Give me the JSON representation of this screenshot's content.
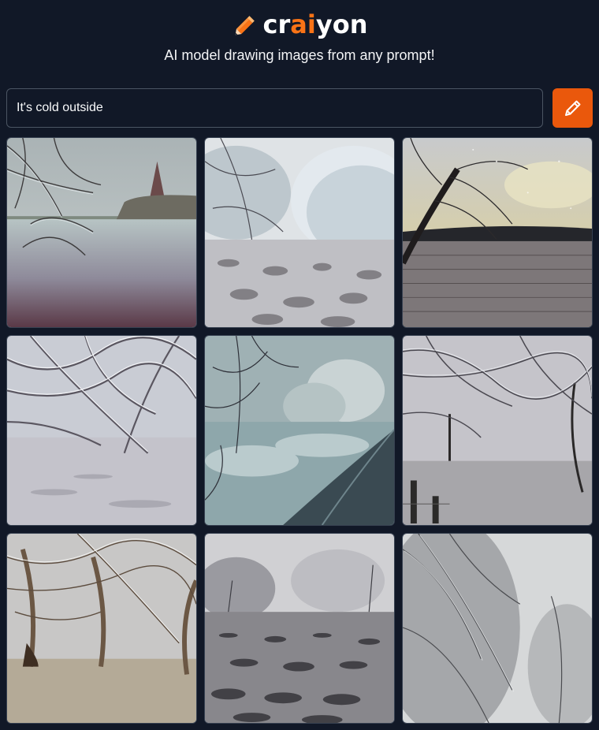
{
  "brand": {
    "logo_parts": [
      "cr",
      "ai",
      "yon"
    ],
    "accent_color": "#f97316",
    "logo_icon": "pencil-icon"
  },
  "tagline": "AI model drawing images from any prompt!",
  "prompt": {
    "value": "It's cold outside",
    "placeholder": ""
  },
  "draw_button": {
    "icon": "pencil-icon",
    "color": "#ea580c"
  },
  "results": {
    "count": 9,
    "images": [
      {
        "scene": "frosted-branches-field-fir-tree"
      },
      {
        "scene": "frosted-trees-snowy-field"
      },
      {
        "scene": "frosted-tree-sunset-field"
      },
      {
        "scene": "snow-laden-branches-snowy-ground"
      },
      {
        "scene": "frosted-road-trees-fog"
      },
      {
        "scene": "snowy-branches-fence-posts"
      },
      {
        "scene": "snow-covered-tree-trunks"
      },
      {
        "scene": "foggy-frost-field"
      },
      {
        "scene": "frosted-tree-canopy"
      }
    ]
  }
}
